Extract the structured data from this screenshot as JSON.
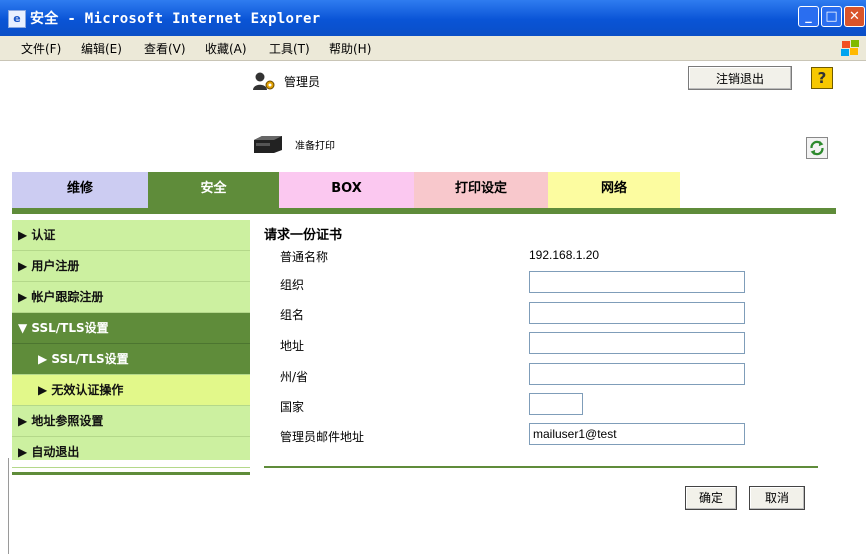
{
  "window": {
    "title": "安全 - Microsoft Internet Explorer"
  },
  "menubar": {
    "items": [
      "文件(F)",
      "编辑(E)",
      "查看(V)",
      "收藏(A)",
      "工具(T)",
      "帮助(H)"
    ]
  },
  "header": {
    "admin_label": "管理员",
    "logout_label": "注销退出",
    "help_label": "?",
    "printer_status": "准备打印"
  },
  "tabs": [
    {
      "label": "维修"
    },
    {
      "label": "安全"
    },
    {
      "label": "BOX"
    },
    {
      "label": "打印设定"
    },
    {
      "label": "网络"
    }
  ],
  "sidebar": {
    "items": [
      {
        "label": "▶ 认证"
      },
      {
        "label": "▶ 用户注册"
      },
      {
        "label": "▶ 帐户跟踪注册"
      },
      {
        "label": "▼ SSL/TLS设置"
      },
      {
        "label": "▶ SSL/TLS设置"
      },
      {
        "label": "▶ 无效认证操作"
      },
      {
        "label": "▶ 地址参照设置"
      },
      {
        "label": "▶ 自动退出"
      }
    ]
  },
  "form": {
    "heading": "请求一份证书",
    "common_name": {
      "label": "普通名称",
      "value": "192.168.1.20"
    },
    "organization": {
      "label": "组织",
      "value": ""
    },
    "org_unit": {
      "label": "组名",
      "value": ""
    },
    "address": {
      "label": "地址",
      "value": ""
    },
    "state": {
      "label": "州/省",
      "value": ""
    },
    "country": {
      "label": "国家",
      "value": ""
    },
    "admin_email": {
      "label": "管理员邮件地址",
      "value": "mailuser1@test"
    },
    "ok_label": "确定",
    "cancel_label": "取消"
  },
  "colors": {
    "accent_green": "#5f8c3a",
    "sidebar_bg": "#ccf0a0",
    "selected_sub": "#e2f88a",
    "tab_maintenance": "#ccccf2",
    "tab_box": "#fbc8f0",
    "tab_print": "#f8c8cc",
    "tab_network": "#fcfca0"
  }
}
